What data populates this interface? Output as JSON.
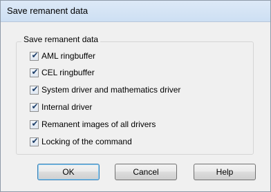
{
  "dialog": {
    "title": "Save remanent data",
    "group_label": "Save remanent data",
    "options": [
      {
        "label": "AML ringbuffer",
        "checked": true
      },
      {
        "label": "CEL ringbuffer",
        "checked": true
      },
      {
        "label": "System driver and mathematics driver",
        "checked": true
      },
      {
        "label": "Internal driver",
        "checked": true
      },
      {
        "label": "Remanent images of all drivers",
        "checked": true
      },
      {
        "label": "Locking of the command",
        "checked": true
      }
    ],
    "buttons": {
      "ok": "OK",
      "cancel": "Cancel",
      "help": "Help"
    },
    "check_glyph": "✔"
  }
}
